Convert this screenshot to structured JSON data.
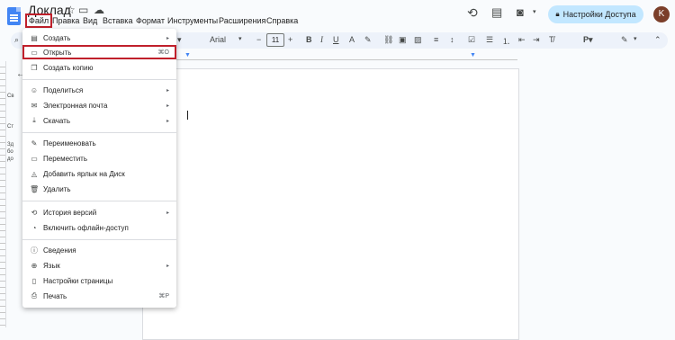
{
  "header": {
    "title": "Доклад",
    "menu": [
      "Файл",
      "Правка",
      "Вид",
      "Вставка",
      "Формат",
      "Инструменты",
      "Расширения",
      "Справка"
    ],
    "share_label": "Настройки Доступа",
    "avatar_letter": "K"
  },
  "toolbar": {
    "font": "Arial",
    "font_size": "11"
  },
  "left_pane": {
    "line1": "Св",
    "line2": "Ст",
    "line3": "Зд",
    "line4": "бо",
    "line5": "до"
  },
  "file_menu": {
    "items": [
      {
        "label": "Создать",
        "icon": "doc-icon",
        "arrow": "▸",
        "shortcut": ""
      },
      {
        "label": "Открыть",
        "icon": "folder-icon",
        "arrow": "",
        "shortcut": "⌘O"
      },
      {
        "label": "Создать копию",
        "icon": "copy-icon",
        "arrow": "",
        "shortcut": ""
      },
      {
        "label": "Поделиться",
        "icon": "person-add-icon",
        "arrow": "▸",
        "shortcut": ""
      },
      {
        "label": "Электронная почта",
        "icon": "mail-icon",
        "arrow": "▸",
        "shortcut": ""
      },
      {
        "label": "Скачать",
        "icon": "download-icon",
        "arrow": "▸",
        "shortcut": ""
      },
      {
        "label": "Переименовать",
        "icon": "rename-icon",
        "arrow": "",
        "shortcut": ""
      },
      {
        "label": "Переместить",
        "icon": "move-folder-icon",
        "arrow": "",
        "shortcut": ""
      },
      {
        "label": "Добавить ярлык на Диск",
        "icon": "drive-shortcut-icon",
        "arrow": "",
        "shortcut": ""
      },
      {
        "label": "Удалить",
        "icon": "trash-icon",
        "arrow": "",
        "shortcut": ""
      },
      {
        "label": "История версий",
        "icon": "history-icon",
        "arrow": "▸",
        "shortcut": ""
      },
      {
        "label": "Включить офлайн-доступ",
        "icon": "offline-icon",
        "arrow": "",
        "shortcut": ""
      },
      {
        "label": "Сведения",
        "icon": "info-icon",
        "arrow": "",
        "shortcut": ""
      },
      {
        "label": "Язык",
        "icon": "globe-icon",
        "arrow": "▸",
        "shortcut": ""
      },
      {
        "label": "Настройки страницы",
        "icon": "page-setup-icon",
        "arrow": "",
        "shortcut": ""
      },
      {
        "label": "Печать",
        "icon": "print-icon",
        "arrow": "",
        "shortcut": "⌘P"
      }
    ]
  }
}
